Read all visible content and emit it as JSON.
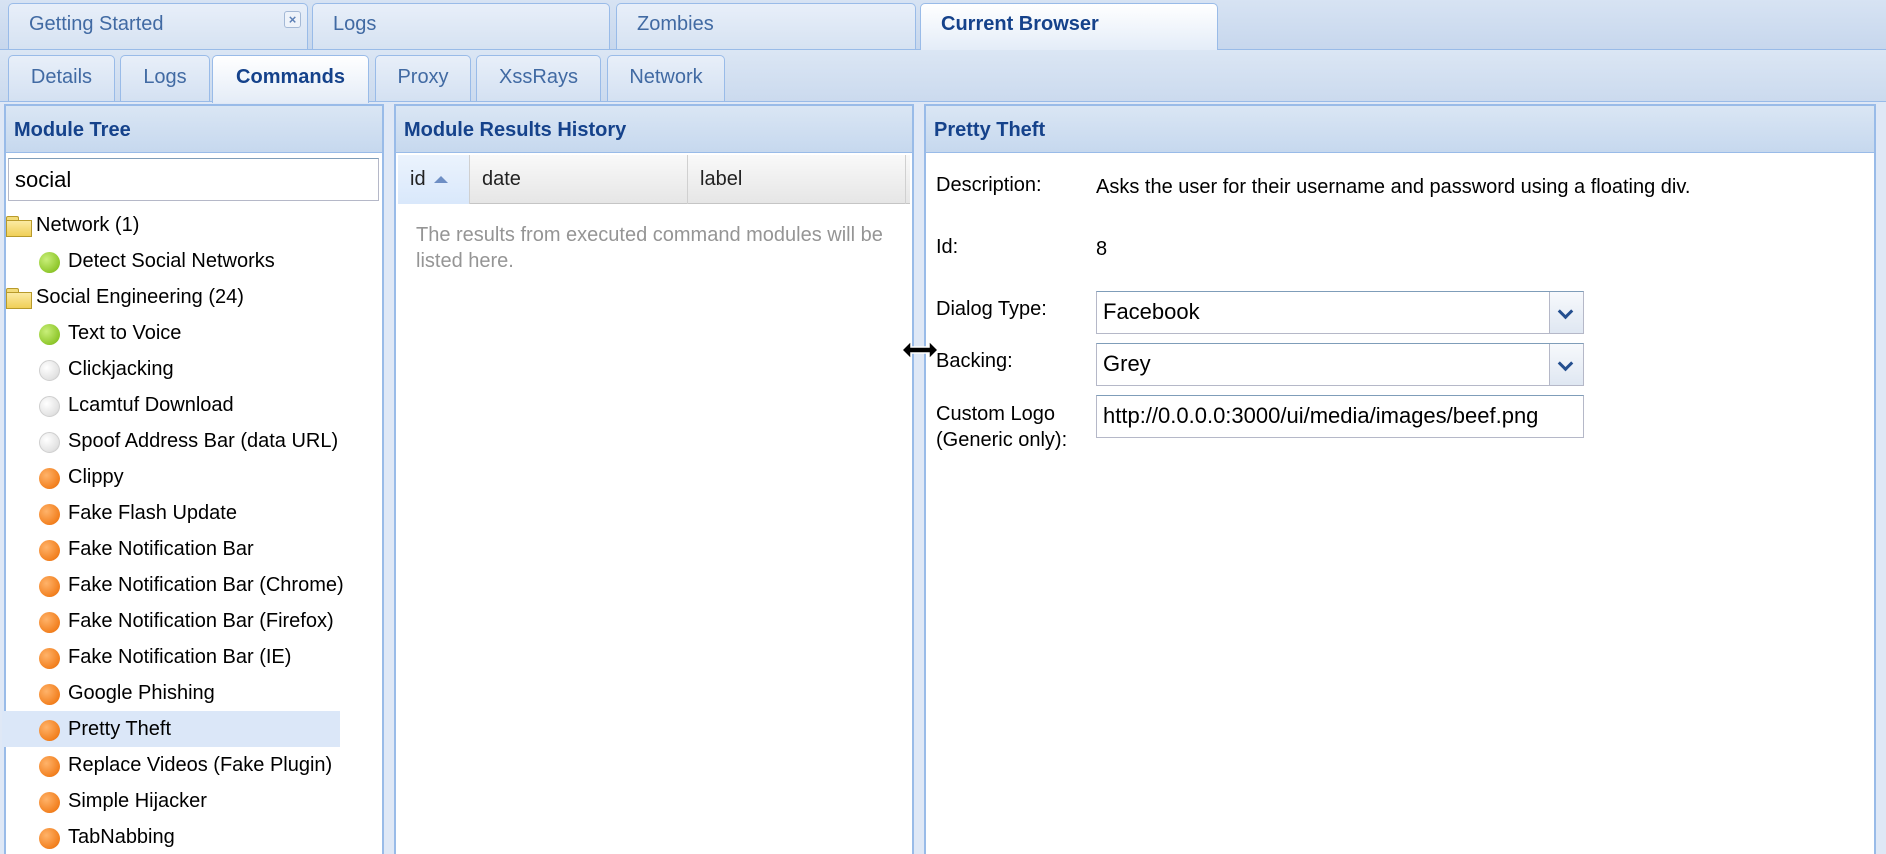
{
  "top_tabs": [
    {
      "label": "Getting Started",
      "closable": true
    },
    {
      "label": "Logs"
    },
    {
      "label": "Zombies"
    },
    {
      "label": "Current Browser",
      "active": true
    }
  ],
  "sub_tabs": [
    {
      "label": "Details"
    },
    {
      "label": "Logs"
    },
    {
      "label": "Commands",
      "active": true
    },
    {
      "label": "Proxy"
    },
    {
      "label": "XssRays"
    },
    {
      "label": "Network"
    }
  ],
  "module_tree": {
    "title": "Module Tree",
    "search_value": "social",
    "items": [
      {
        "type": "folder",
        "label": "Network (1)"
      },
      {
        "type": "module",
        "status": "green",
        "label": "Detect Social Networks"
      },
      {
        "type": "folder",
        "label": "Social Engineering (24)"
      },
      {
        "type": "module",
        "status": "green",
        "label": "Text to Voice"
      },
      {
        "type": "module",
        "status": "white",
        "label": "Clickjacking"
      },
      {
        "type": "module",
        "status": "white",
        "label": "Lcamtuf Download"
      },
      {
        "type": "module",
        "status": "white",
        "label": "Spoof Address Bar (data URL)"
      },
      {
        "type": "module",
        "status": "orange",
        "label": "Clippy"
      },
      {
        "type": "module",
        "status": "orange",
        "label": "Fake Flash Update"
      },
      {
        "type": "module",
        "status": "orange",
        "label": "Fake Notification Bar"
      },
      {
        "type": "module",
        "status": "orange",
        "label": "Fake Notification Bar (Chrome)"
      },
      {
        "type": "module",
        "status": "orange",
        "label": "Fake Notification Bar (Firefox)"
      },
      {
        "type": "module",
        "status": "orange",
        "label": "Fake Notification Bar (IE)"
      },
      {
        "type": "module",
        "status": "orange",
        "label": "Google Phishing"
      },
      {
        "type": "module",
        "status": "orange",
        "label": "Pretty Theft",
        "selected": true
      },
      {
        "type": "module",
        "status": "orange",
        "label": "Replace Videos (Fake Plugin)"
      },
      {
        "type": "module",
        "status": "orange",
        "label": "Simple Hijacker"
      },
      {
        "type": "module",
        "status": "orange",
        "label": "TabNabbing"
      }
    ]
  },
  "results_history": {
    "title": "Module Results History",
    "columns": [
      "id",
      "date",
      "label"
    ],
    "sorted_column": "id",
    "empty_text": "The results from executed command modules will be listed here."
  },
  "details": {
    "title": "Pretty Theft",
    "description_label": "Description:",
    "description": "Asks the user for their username and password using a floating div.",
    "id_label": "Id:",
    "id_value": "8",
    "dialog_type_label": "Dialog Type:",
    "dialog_type_value": "Facebook",
    "backing_label": "Backing:",
    "backing_value": "Grey",
    "custom_logo_label_1": "Custom Logo",
    "custom_logo_label_2": "(Generic only):",
    "custom_logo_value": "http://0.0.0.0:3000/ui/media/images/beef.png"
  },
  "icons": {
    "folder": "folder-icon",
    "module_green": "status-green-icon",
    "module_white": "status-white-icon",
    "module_orange": "status-orange-icon",
    "close": "close-icon",
    "sort_asc": "sort-ascending-icon",
    "dropdown": "chevron-down-icon",
    "resize": "resize-horizontal-cursor-icon"
  },
  "colors": {
    "header_text": "#15428b",
    "tab_text": "#416aa3",
    "panel_border": "#99bbe8",
    "selected_row": "#dbe7f8",
    "status_green": "#8fc72c",
    "status_orange": "#f2801f",
    "status_white": "#e2e2e2"
  }
}
